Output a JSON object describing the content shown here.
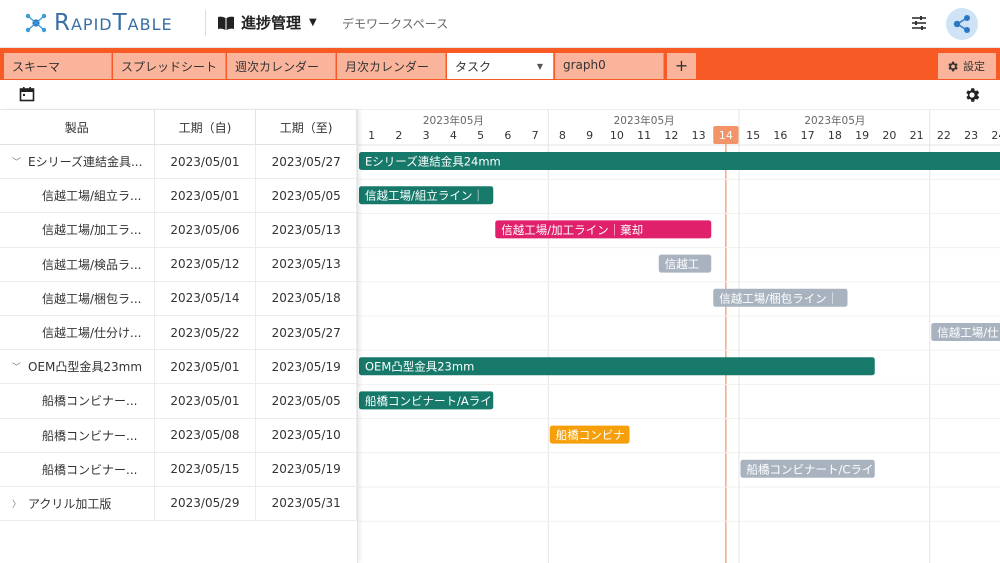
{
  "app": {
    "logo_text": "RapidTable",
    "title": "進捗管理",
    "workspace": "デモワークスペース"
  },
  "tabs": [
    {
      "label": "スキーマ",
      "active": false
    },
    {
      "label": "スプレッドシート",
      "active": false
    },
    {
      "label": "週次カレンダー",
      "active": false
    },
    {
      "label": "月次カレンダー",
      "active": false
    },
    {
      "label": "タスク",
      "active": true
    },
    {
      "label": "graph0",
      "active": false
    }
  ],
  "tab_add_label": "+",
  "settings_label": "設定",
  "table": {
    "headers": [
      "製品",
      "工期（自)",
      "工期（至)"
    ],
    "rows": [
      {
        "name": "Eシリーズ連結金具...",
        "start": "2023/05/01",
        "end": "2023/05/27",
        "level": 0,
        "expand": "expanded"
      },
      {
        "name": "信越工場/組立ラ...",
        "start": "2023/05/01",
        "end": "2023/05/05",
        "level": 1,
        "expand": "none"
      },
      {
        "name": "信越工場/加工ラ...",
        "start": "2023/05/06",
        "end": "2023/05/13",
        "level": 1,
        "expand": "none"
      },
      {
        "name": "信越工場/検品ラ...",
        "start": "2023/05/12",
        "end": "2023/05/13",
        "level": 1,
        "expand": "none"
      },
      {
        "name": "信越工場/梱包ラ...",
        "start": "2023/05/14",
        "end": "2023/05/18",
        "level": 1,
        "expand": "none"
      },
      {
        "name": "信越工場/仕分け...",
        "start": "2023/05/22",
        "end": "2023/05/27",
        "level": 1,
        "expand": "none"
      },
      {
        "name": "OEM凸型金具23mm",
        "start": "2023/05/01",
        "end": "2023/05/19",
        "level": 0,
        "expand": "expanded"
      },
      {
        "name": "船橋コンビナー...",
        "start": "2023/05/01",
        "end": "2023/05/05",
        "level": 1,
        "expand": "none"
      },
      {
        "name": "船橋コンビナー...",
        "start": "2023/05/08",
        "end": "2023/05/10",
        "level": 1,
        "expand": "none"
      },
      {
        "name": "船橋コンビナー...",
        "start": "2023/05/15",
        "end": "2023/05/19",
        "level": 1,
        "expand": "none"
      },
      {
        "name": "アクリル加工版",
        "start": "2023/05/29",
        "end": "2023/05/31",
        "level": 0,
        "expand": "collapsed"
      }
    ]
  },
  "gantt": {
    "month_label": "2023年05月",
    "day_labels": [
      "1",
      "2",
      "3",
      "4",
      "5",
      "6",
      "7",
      "8",
      "9",
      "10",
      "11",
      "12",
      "13",
      "14",
      "15",
      "16",
      "17",
      "18",
      "19",
      "20",
      "21",
      "22",
      "23",
      "24"
    ],
    "today": 14,
    "colors": {
      "teal": "#16796a",
      "pink": "#e0206a",
      "gray": "#a9b3bf",
      "orange": "#f5a00a",
      "today": "#f39368"
    },
    "bars": [
      {
        "row": 0,
        "start": 1,
        "end": 27,
        "label": "Eシリーズ連結金具24mm",
        "color": "teal"
      },
      {
        "row": 1,
        "start": 1,
        "end": 5,
        "label": "信越工場/組立ライン｜",
        "color": "teal"
      },
      {
        "row": 2,
        "start": 6,
        "end": 13,
        "label": "信越工場/加工ライン｜棄却",
        "color": "pink"
      },
      {
        "row": 3,
        "start": 12,
        "end": 13,
        "label": "信越工",
        "color": "gray"
      },
      {
        "row": 4,
        "start": 14,
        "end": 18,
        "label": "信越工場/梱包ライン｜",
        "color": "gray"
      },
      {
        "row": 5,
        "start": 22,
        "end": 27,
        "label": "信越工場/仕",
        "color": "gray"
      },
      {
        "row": 6,
        "start": 1,
        "end": 19,
        "label": "OEM凸型金具23mm",
        "color": "teal"
      },
      {
        "row": 7,
        "start": 1,
        "end": 5,
        "label": "船橋コンビナート/Aライ",
        "color": "teal"
      },
      {
        "row": 8,
        "start": 8,
        "end": 10,
        "label": "船橋コンビナ",
        "color": "orange"
      },
      {
        "row": 9,
        "start": 15,
        "end": 19,
        "label": "船橋コンビナート/Cライ",
        "color": "gray"
      }
    ]
  }
}
